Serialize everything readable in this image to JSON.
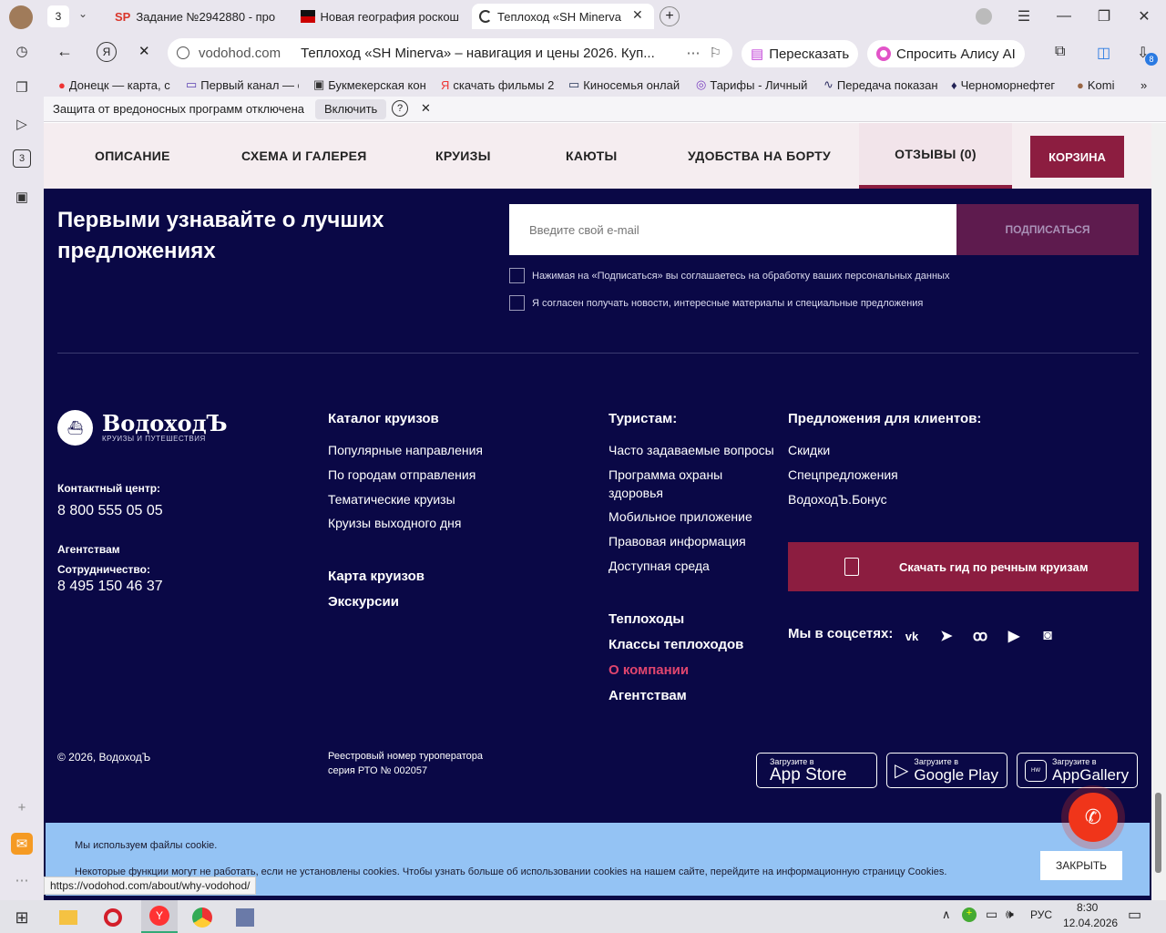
{
  "browser": {
    "tab_count": "3",
    "tabs": [
      {
        "icon": "sp-icon",
        "title": "Задание №2942880 - про"
      },
      {
        "icon": "flag-icon",
        "title": "Новая география роскош"
      },
      {
        "icon": "loading-icon",
        "title": "Теплоход «SH Minerva"
      }
    ],
    "address": {
      "domain": "vodohod.com",
      "page_title": "Теплоход «SH Minerva» – навигация и цены 2026. Куп..."
    },
    "retell_label": "Пересказать",
    "ask_alice_label": "Спросить Алису AI",
    "downloads_badge": "8",
    "bookmarks": [
      "Донецк — карта, с",
      "Первый канал — с",
      "Букмекерская кон",
      "скачать фильмы 2",
      "Киносемья онлай",
      "Тарифы - Личный",
      "Передача показан",
      "Черноморнефтег",
      "Komi"
    ],
    "infobar": {
      "text": "Защита от вредоносных программ отключена",
      "enable_label": "Включить"
    },
    "status_url": "https://vodohod.com/about/why-vodohod/"
  },
  "site": {
    "nav": [
      "ОПИСАНИЕ",
      "СХЕМА И ГАЛЕРЕЯ",
      "КРУИЗЫ",
      "КАЮТЫ",
      "УДОБСТВА НА БОРТУ",
      "ОТЗЫВЫ (0)"
    ],
    "cart_label": "КОРЗИНА",
    "subscribe": {
      "heading": "Первыми узнавайте о лучших предложениях",
      "placeholder": "Введите свой e-mail",
      "button": "ПОДПИСАТЬСЯ",
      "consent1": "Нажимая на «Подписаться» вы соглашаетесь на обработку ваших персональных данных",
      "consent2": "Я согласен получать новости, интересные материалы и специальные предложения"
    },
    "logo": {
      "name": "ВодоходЪ",
      "tagline": "КРУИЗЫ И ПУТЕШЕСТВИЯ"
    },
    "contact": {
      "label": "Контактный центр:",
      "phone": "8 800 555 05 05",
      "agents": "Агентствам",
      "coop_label": "Сотрудничество:",
      "coop_phone": "8 495 150 46 37"
    },
    "catalog": {
      "title": "Каталог круизов",
      "items": [
        "Популярные направления",
        "По городам отправления",
        "Тематические круизы",
        "Круизы выходного дня"
      ],
      "map": "Карта круизов",
      "excursions": "Экскурсии"
    },
    "tourists": {
      "title": "Туристам:",
      "items": [
        "Часто задаваемые вопросы",
        "Программа охраны",
        "здоровья",
        "Мобильное приложение",
        "Правовая информация",
        "Доступная среда"
      ],
      "ships": "Теплоходы",
      "ship_classes": "Классы теплоходов",
      "about": "О компании",
      "agencies": "Агентствам"
    },
    "offers": {
      "title": "Предложения для клиентов:",
      "items": [
        "Скидки",
        "Спецпредложения",
        "ВодоходЪ.Бонус"
      ],
      "guide": "Скачать гид по речным круизам",
      "social_label": "Мы в соцсетях:"
    },
    "copyright": "© 2026, ВодоходЪ",
    "registry": [
      "Реестровый номер туроператора",
      "серия РТО № 002057"
    ],
    "stores": [
      {
        "small": "Загрузите в",
        "big": "App Store"
      },
      {
        "small": "Загрузите в",
        "big": "Google Play"
      },
      {
        "small": "Загрузите в",
        "big": "AppGallery"
      }
    ],
    "cookie": {
      "line1": "Мы используем файлы cookie.",
      "line2": "Некоторые функции могут не работать, если не установлены cookies. Чтобы узнать больше об использовании cookies на нашем сайте, перейдите на информационную страницу Cookies.",
      "close": "ЗАКРЫТЬ"
    }
  },
  "taskbar": {
    "lang": "РУС",
    "time": "8:30",
    "date": "12.04.2026"
  },
  "colors": {
    "footer_bg": "#0a0846",
    "accent": "#8c1d40",
    "about_link": "#e0456e",
    "cookie_bg": "#94c3f4",
    "call_button": "#f0351a"
  }
}
